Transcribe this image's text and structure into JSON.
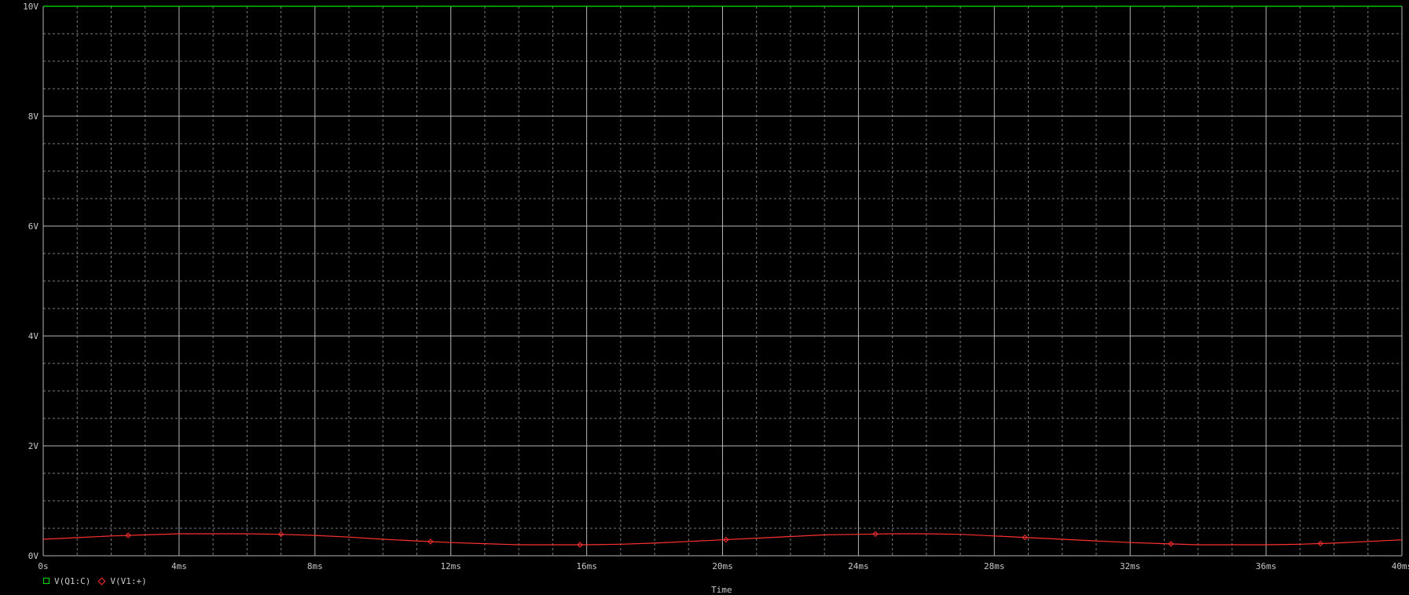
{
  "chart_data": {
    "type": "line",
    "xlabel": "Time",
    "ylabel": "",
    "xlim": [
      0,
      40
    ],
    "ylim": [
      0,
      10
    ],
    "x_ticks": [
      0,
      4,
      8,
      12,
      16,
      20,
      24,
      28,
      32,
      36,
      40
    ],
    "x_tick_labels": [
      "0s",
      "4ms",
      "8ms",
      "12ms",
      "16ms",
      "20ms",
      "24ms",
      "28ms",
      "32ms",
      "36ms",
      "40ms"
    ],
    "y_ticks": [
      0,
      2,
      4,
      6,
      8,
      10
    ],
    "y_tick_labels": [
      "0V",
      "2V",
      "4V",
      "6V",
      "8V",
      "10V"
    ],
    "grid": true,
    "legend_position": "bottom-left",
    "series": [
      {
        "name": "V(Q1:C)",
        "color": "#00e000",
        "marker": "square",
        "x": [
          0,
          40
        ],
        "y": [
          10,
          10
        ]
      },
      {
        "name": "V(V1:+)",
        "color": "#ff3030",
        "marker": "diamond",
        "x": [
          0,
          1,
          2,
          3,
          4,
          5,
          6,
          7,
          8,
          9,
          10,
          11,
          12,
          13,
          14,
          15,
          16,
          17,
          18,
          19,
          20,
          21,
          22,
          23,
          24,
          25,
          26,
          27,
          28,
          29,
          30,
          31,
          32,
          33,
          34,
          35,
          36,
          37,
          38,
          39,
          40
        ],
        "y": [
          0.3,
          0.33,
          0.36,
          0.38,
          0.4,
          0.4,
          0.4,
          0.39,
          0.37,
          0.34,
          0.3,
          0.27,
          0.24,
          0.22,
          0.2,
          0.2,
          0.2,
          0.21,
          0.23,
          0.26,
          0.29,
          0.32,
          0.35,
          0.38,
          0.39,
          0.4,
          0.4,
          0.39,
          0.36,
          0.33,
          0.3,
          0.27,
          0.24,
          0.22,
          0.2,
          0.2,
          0.2,
          0.21,
          0.23,
          0.26,
          0.29
        ],
        "marker_x": [
          2.5,
          7,
          11.4,
          15.8,
          20.1,
          24.5,
          28.9,
          33.2,
          37.6
        ]
      }
    ]
  }
}
